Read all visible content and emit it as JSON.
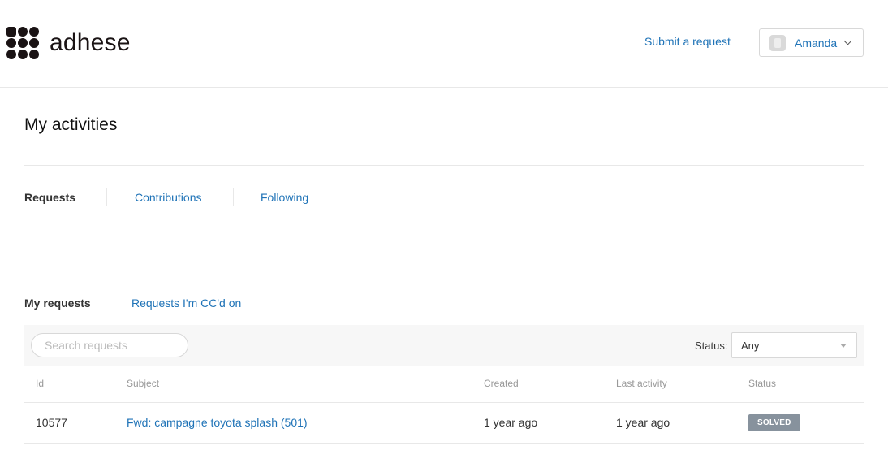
{
  "brand": {
    "name": "adhese",
    "logo_color": "#1a1314"
  },
  "header": {
    "submit_request": "Submit a request",
    "user": {
      "name": "Amanda",
      "avatar": "avatar-icon",
      "menu_icon": "chevron-down-icon"
    }
  },
  "page": {
    "title": "My activities"
  },
  "tabs": [
    {
      "label": "Requests",
      "active": true
    },
    {
      "label": "Contributions",
      "active": false
    },
    {
      "label": "Following",
      "active": false
    }
  ],
  "subtabs": [
    {
      "label": "My requests",
      "active": true
    },
    {
      "label": "Requests I'm CC'd on",
      "active": false
    }
  ],
  "filters": {
    "search": {
      "placeholder": "Search requests",
      "value": ""
    },
    "status": {
      "label": "Status:",
      "value": "Any"
    }
  },
  "table": {
    "columns": [
      "Id",
      "Subject",
      "Created",
      "Last activity",
      "Status"
    ],
    "rows": [
      {
        "id": "10577",
        "subject": "Fwd: campagne toyota splash (501)",
        "created": "1 year ago",
        "last_activity": "1 year ago",
        "status": "SOLVED"
      }
    ]
  },
  "colors": {
    "link": "#1f73b7",
    "text": "#333333",
    "muted": "#999999",
    "badge_solved": "#87929d",
    "filter_bg": "#f7f7f7"
  }
}
